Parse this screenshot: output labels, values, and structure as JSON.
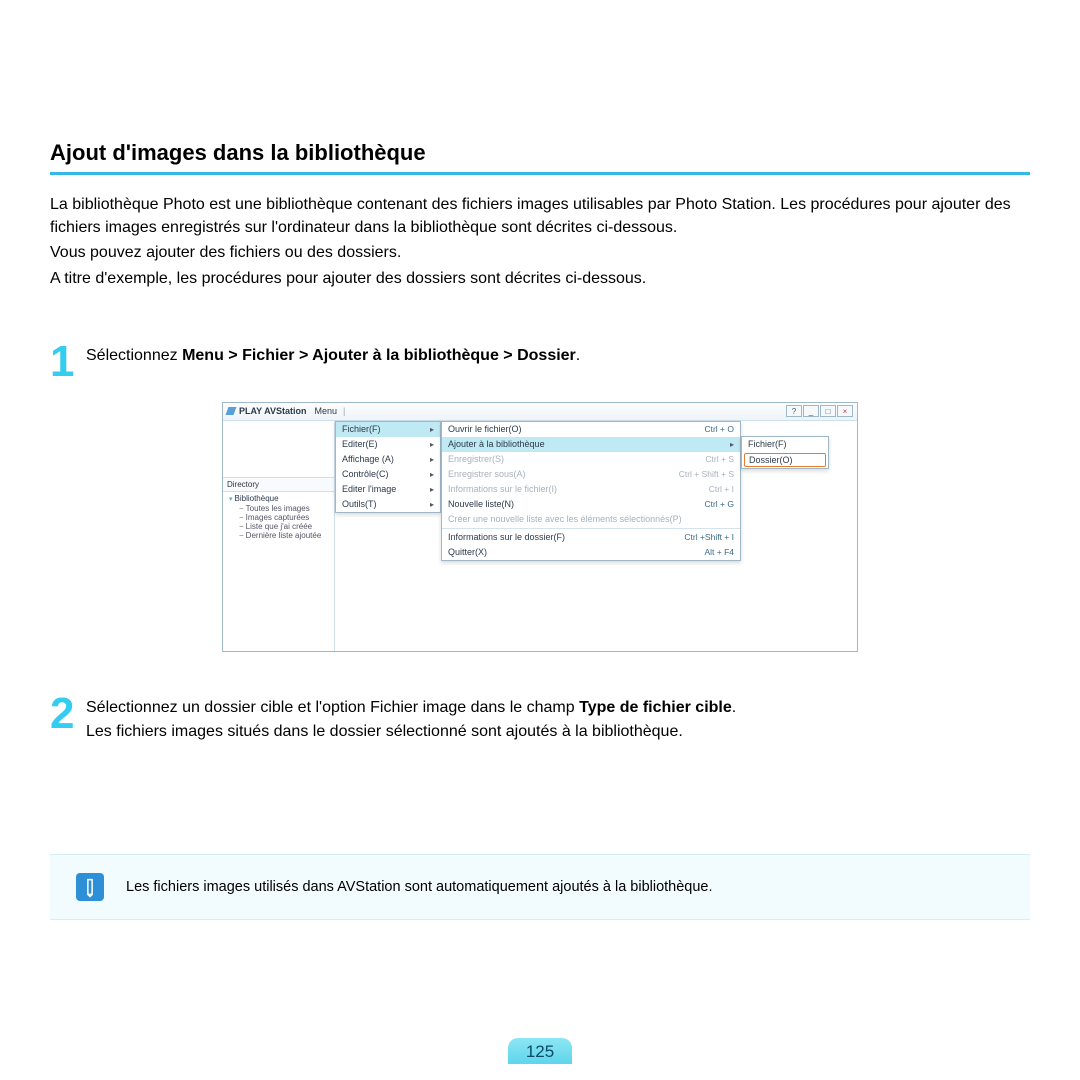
{
  "section_title": "Ajout d'images dans la bibliothèque",
  "intro": [
    "La bibliothèque Photo est une bibliothèque contenant des fichiers images utilisables par Photo Station. Les procédures pour ajouter des fichiers images enregistrés sur l'ordinateur dans la bibliothèque sont décrites ci-dessous.",
    "Vous pouvez ajouter des fichiers ou des dossiers.",
    "A titre d'exemple, les procédures pour ajouter des dossiers sont décrites ci-dessous."
  ],
  "steps": {
    "1": {
      "prefix": "Sélectionnez ",
      "bold": "Menu > Fichier > Ajouter à la bibliothèque > Dossier",
      "suffix": "."
    },
    "2": {
      "line1_pre": "Sélectionnez un dossier cible et l'option Fichier image dans le champ ",
      "line1_bold": "Type de fichier cible",
      "line1_post": ".",
      "line2": "Les fichiers images situés dans le dossier sélectionné sont ajoutés à la bibliothèque."
    }
  },
  "app": {
    "title": "PLAY AVStation",
    "menu_label": "Menu",
    "win_buttons": {
      "help": "?",
      "min": "_",
      "max": "□",
      "close": "×"
    },
    "sidebar": {
      "header": "Directory",
      "root": "Bibliothèque",
      "items": [
        "Toutes les images",
        "Images capturées",
        "Liste que j'ai créée",
        "Dernière liste ajoutée"
      ]
    },
    "menu_left": [
      {
        "label": "Fichier(F)",
        "sel": true
      },
      {
        "label": "Editer(E)"
      },
      {
        "label": "Affichage (A)"
      },
      {
        "label": "Contrôle(C)"
      },
      {
        "label": "Editer l'image"
      },
      {
        "label": "Outils(T)"
      }
    ],
    "menu_mid": [
      {
        "label": "Ouvrir le fichier(O)",
        "shortcut": "Ctrl + O"
      },
      {
        "label": "Ajouter à la bibliothèque",
        "shortcut": "",
        "sel": true,
        "arrow": true
      },
      {
        "label": "Enregistrer(S)",
        "shortcut": "Ctrl + S",
        "disabled": true
      },
      {
        "label": "Enregistrer sous(A)",
        "shortcut": "Ctrl + Shift + S",
        "disabled": true
      },
      {
        "label": "Informations sur le fichier(I)",
        "shortcut": "Ctrl + I",
        "disabled": true
      },
      {
        "label": "Nouvelle liste(N)",
        "shortcut": "Ctrl + G"
      },
      {
        "label": "Créer une nouvelle liste avec les éléments sélectionnés(P)",
        "shortcut": "",
        "disabled": true
      },
      {
        "sep": true
      },
      {
        "label": "Informations sur le dossier(F)",
        "shortcut": "Ctrl +Shift + I"
      },
      {
        "label": "Quitter(X)",
        "shortcut": "Alt + F4"
      }
    ],
    "menu_right": [
      {
        "label": "Fichier(F)"
      },
      {
        "label": "Dossier(O)",
        "hl": true
      }
    ]
  },
  "note": "Les fichiers images utilisés dans AVStation sont automatiquement ajoutés à la bibliothèque.",
  "page_number": "125"
}
